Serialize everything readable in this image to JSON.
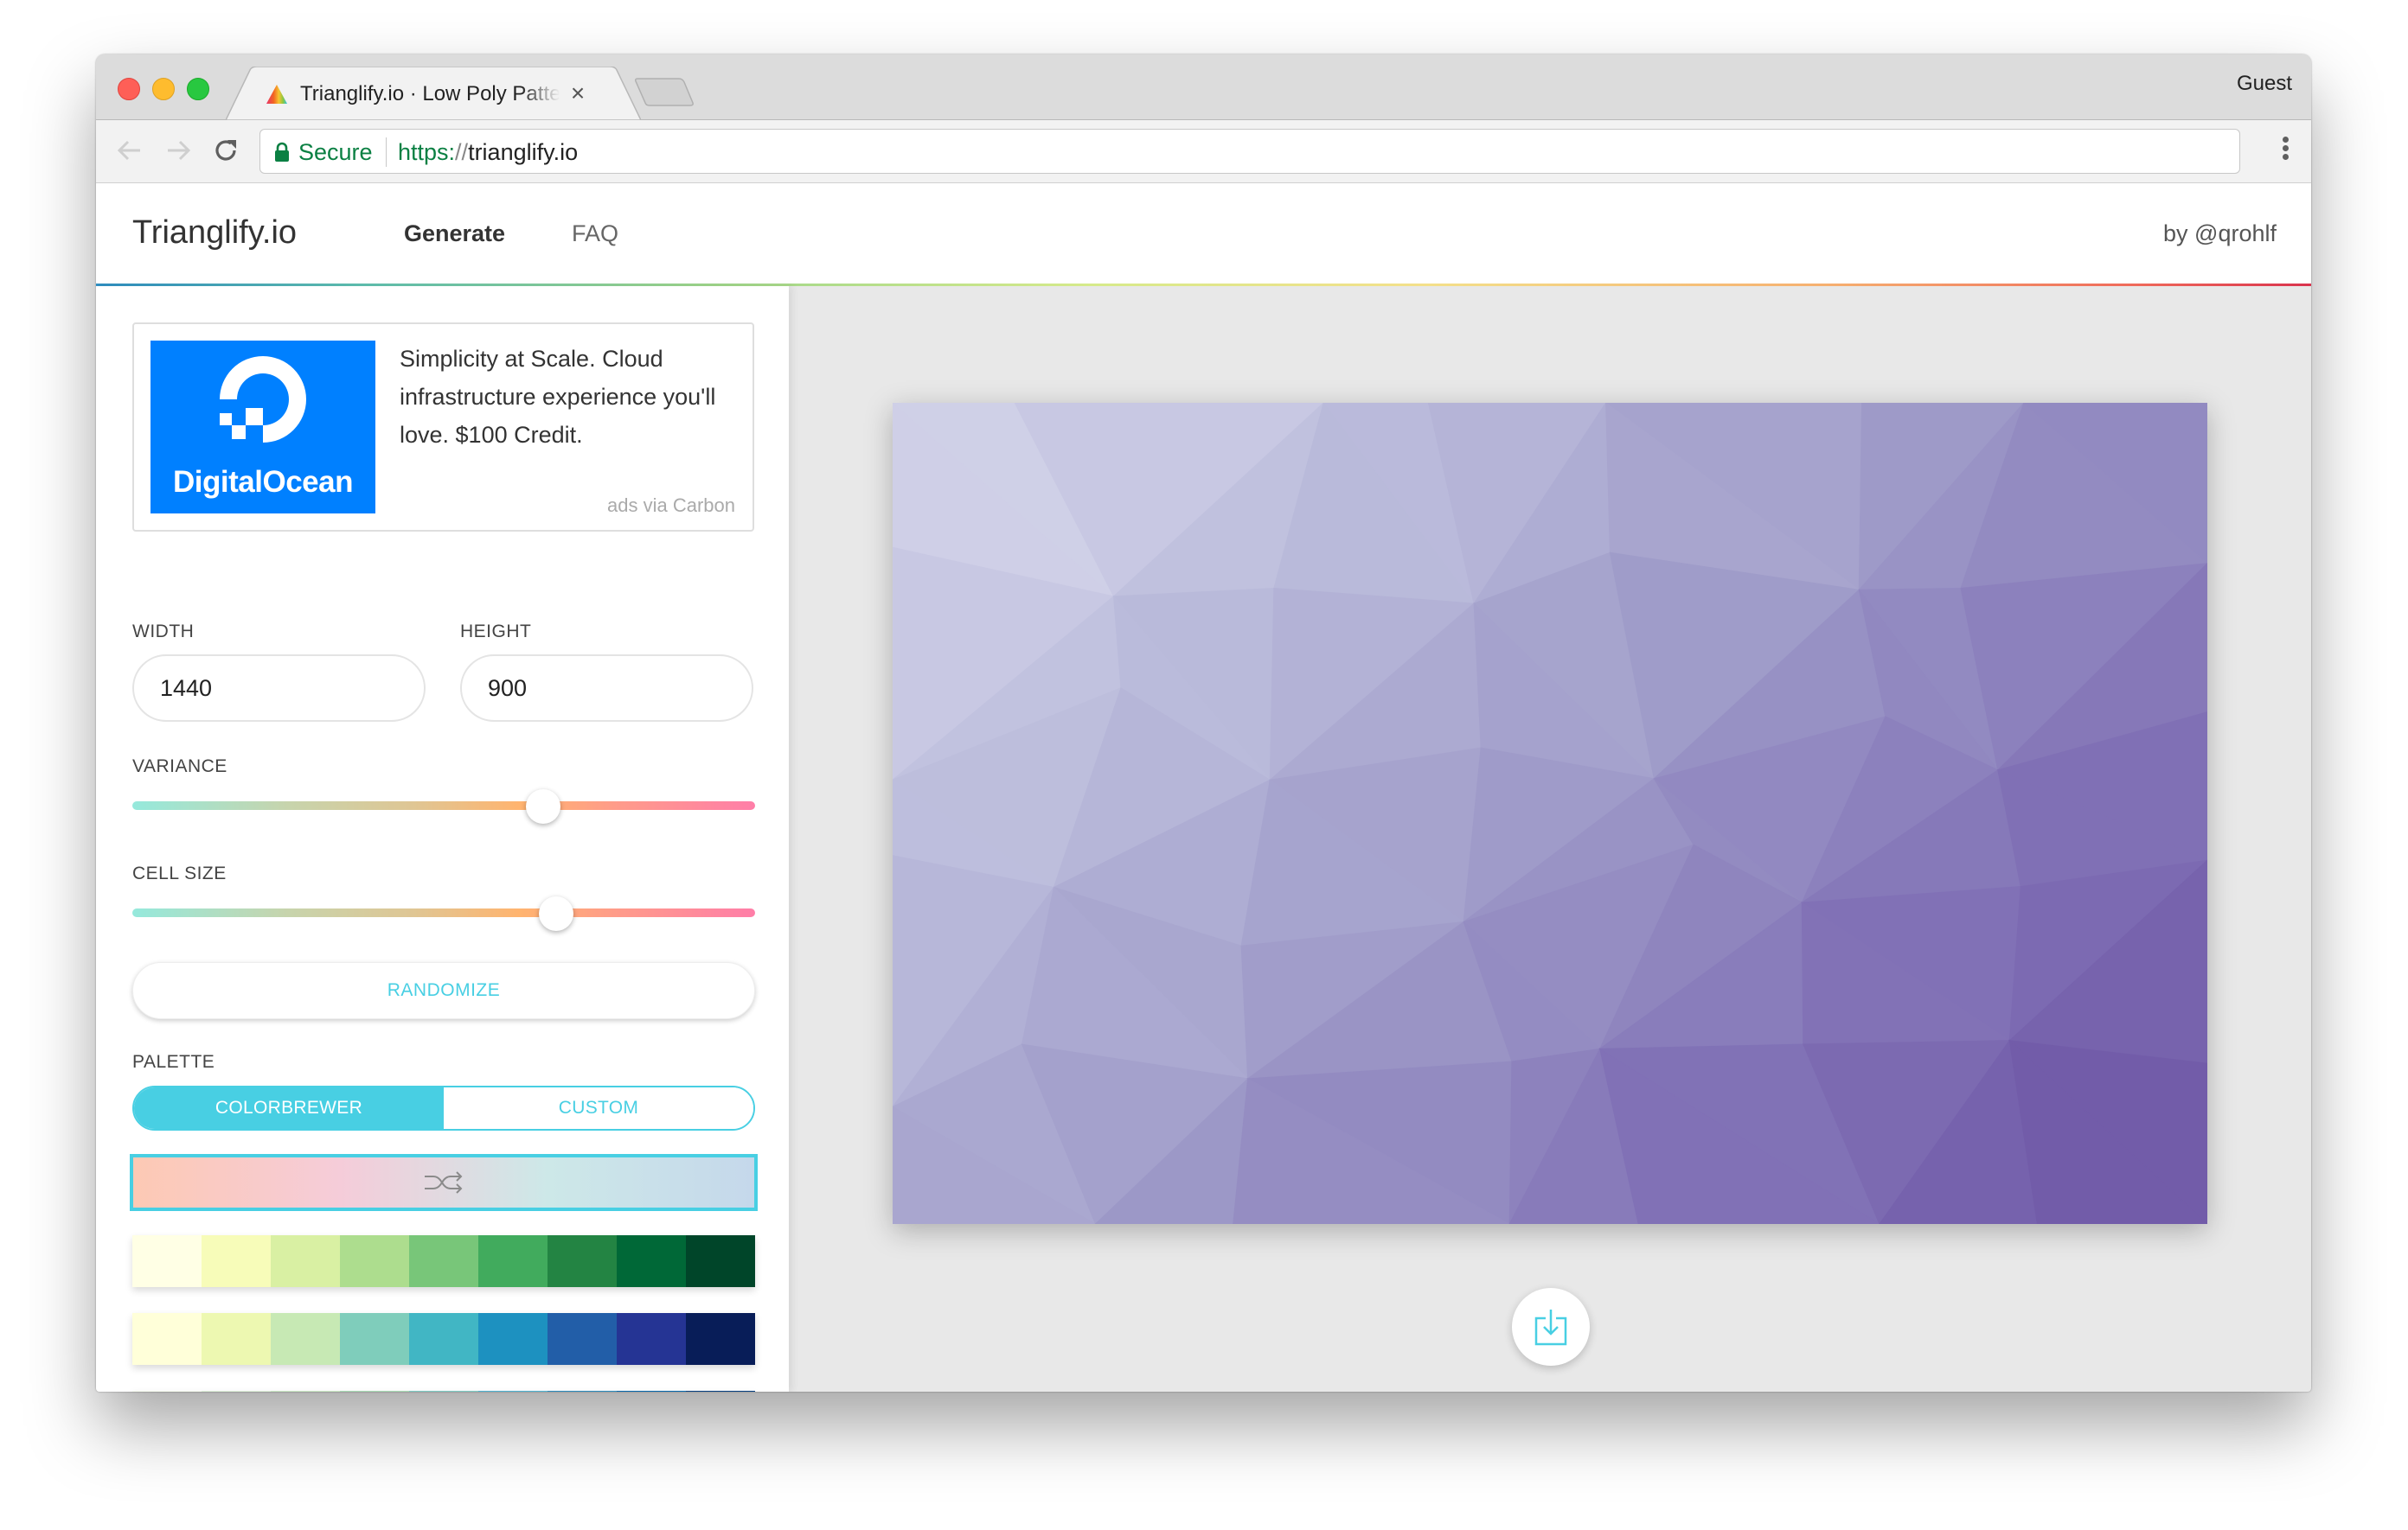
{
  "browser": {
    "tab_title": "Trianglify.io · Low Poly Pattern Generator",
    "tab_close": "×",
    "profile": "Guest",
    "secure_label": "Secure",
    "url_scheme": "https:",
    "url_slashes": "//",
    "url_host": "trianglify.io",
    "icons": [
      "back-arrow-icon",
      "forward-arrow-icon",
      "reload-icon",
      "lock-icon",
      "kebab-menu-icon"
    ]
  },
  "header": {
    "brand": "Trianglify.io",
    "nav": [
      {
        "label": "Generate",
        "active": true
      },
      {
        "label": "FAQ",
        "active": false
      }
    ],
    "byline": "by @qrohlf",
    "rainbow_colors": [
      "#2f8fc2",
      "#9fd68a",
      "#f4e08a",
      "#ef6a5a",
      "#d9334d"
    ]
  },
  "ad": {
    "brand": "DigitalOcean",
    "brand_color": "#0080ff",
    "text": "Simplicity at Scale. Cloud infrastructure experience you'll love. $100 Credit.",
    "via": "ads via Carbon"
  },
  "controls": {
    "width_label": "WIDTH",
    "width_value": "1440",
    "height_label": "HEIGHT",
    "height_value": "900",
    "variance_label": "VARIANCE",
    "variance_value": 0.66,
    "cell_size_label": "CELL SIZE",
    "cell_size_value": 0.68,
    "randomize_label": "RANDOMIZE",
    "palette_label": "PALETTE",
    "palette_modes": [
      {
        "label": "COLORBREWER",
        "active": true
      },
      {
        "label": "CUSTOM",
        "active": false
      }
    ],
    "accent_color": "#48cfe3"
  },
  "palettes": {
    "random": {
      "icon": "shuffle-icon",
      "gradient": [
        "#fdc9b4",
        "#f5ccd9",
        "#cde8e8",
        "#c5d8eb"
      ]
    },
    "list": [
      {
        "name": "YlGn",
        "colors": [
          "#ffffe5",
          "#f7fcb9",
          "#d9f0a3",
          "#addd8e",
          "#78c679",
          "#41ab5d",
          "#238443",
          "#006837",
          "#004529"
        ]
      },
      {
        "name": "YlGnBu",
        "colors": [
          "#ffffd9",
          "#edf8b1",
          "#c7e9b4",
          "#7fcdbb",
          "#41b6c4",
          "#1d91c0",
          "#225ea8",
          "#253494",
          "#081d58"
        ]
      },
      {
        "name": "GnBu",
        "colors": [
          "#f7fcf0",
          "#e0f3db",
          "#ccebc5",
          "#a8ddb5",
          "#7bccc4",
          "#4eb3d3",
          "#2b8cbe",
          "#0868ac",
          "#084081"
        ]
      }
    ]
  },
  "preview": {
    "pattern_width": 1440,
    "pattern_height": 900,
    "colors": [
      "#d9d9ed",
      "#bcbddc",
      "#9e9ac8",
      "#8070b5",
      "#6a51a3"
    ],
    "download_icon": "download-icon"
  }
}
